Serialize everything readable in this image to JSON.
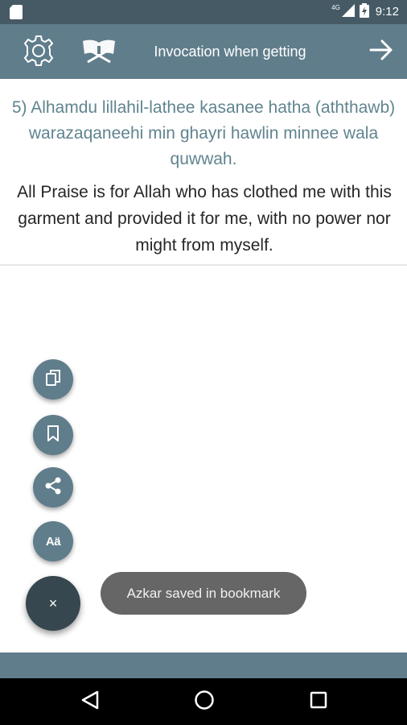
{
  "status_bar": {
    "network_label": "4G",
    "time": "9:12",
    "icons": [
      "sd-card-icon",
      "signal-icon",
      "battery-charging-icon"
    ]
  },
  "app_bar": {
    "title": "Invocation when getting",
    "icons": [
      "gear-icon",
      "quran-book-icon",
      "arrow-right-icon"
    ]
  },
  "content": {
    "transliteration": "5) Alhamdu lillahil-lathee kasanee hatha (aththawb) warazaqaneehi min ghayri hawlin minnee wala quwwah.",
    "translation": "All Praise is for Allah who has clothed me with this garment and provided it for me, with no power nor might from myself."
  },
  "fab_menu": {
    "items": [
      {
        "name": "copy",
        "icon": "copy-icon"
      },
      {
        "name": "bookmark",
        "icon": "bookmark-icon"
      },
      {
        "name": "share",
        "icon": "share-icon"
      },
      {
        "name": "font-size",
        "icon": "font-size-icon",
        "label": "Aä"
      }
    ],
    "close_label": "×"
  },
  "toast": {
    "message": "Azkar saved in bookmark"
  },
  "nav_bar": {
    "icons": [
      "back-triangle-icon",
      "home-circle-icon",
      "recents-square-icon"
    ]
  },
  "colors": {
    "status_bar": "#455a64",
    "app_bar": "#607d8b",
    "accent_text": "#60848f",
    "fab": "#607d8b",
    "fab_close": "#37474f",
    "toast": "#666666"
  }
}
